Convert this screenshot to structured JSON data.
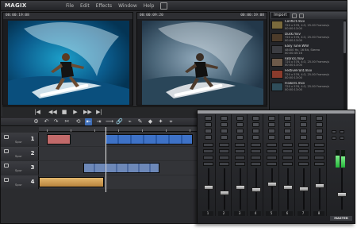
{
  "app": {
    "logo": "MAGIX",
    "menu": [
      "File",
      "Edit",
      "Effects",
      "Window",
      "Help"
    ]
  },
  "monitors": {
    "left_timecode": "00:00:19:08",
    "right_timecode_left": "00:00:09:20",
    "right_timecode_right": "00:00:19:08"
  },
  "import_panel": {
    "tab": "Import",
    "items": [
      {
        "name": "Conflict.mxv",
        "meta": "720 x 576, 4:3, 25.00 Frames/s",
        "dur": "00:00:13:00",
        "thumb": "#7a6a3c"
      },
      {
        "name": "Dusk.mxv",
        "meta": "720 x 576, 4:3, 25.00 Frames/s",
        "dur": "00:00:13:00",
        "thumb": "#4c3b2a"
      },
      {
        "name": "Easy Tune.WAV",
        "meta": "48000 Hz, 16 Bit, Stereo",
        "dur": "00:00:45:16",
        "thumb": "#3c3d42"
      },
      {
        "name": "Fabrics.mxv",
        "meta": "720 x 576, 4:3, 25.00 Frames/s",
        "dur": "00:00:13:00",
        "thumb": "#6d5a4a"
      },
      {
        "name": "FestiveFront.mxv",
        "meta": "720 x 576, 4:3, 25.00 Frames/s",
        "dur": "00:00:13:00",
        "thumb": "#8a3b2c"
      },
      {
        "name": "Flowers.mxv",
        "meta": "720 x 576, 4:3, 25.00 Frames/s",
        "dur": "00:00:13:00",
        "thumb": "#2f4d5a"
      }
    ]
  },
  "transport": {
    "buttons": [
      "|◀",
      "◀◀",
      "■",
      "▶",
      "▶▶",
      "▶|"
    ]
  },
  "toolbar": {
    "tools": [
      "⚙",
      "↶",
      "↷",
      "✂",
      "⟲",
      "⇤",
      "⇥",
      "⟶",
      "🔗",
      "⌁",
      "✎",
      "◆",
      "✦",
      "⌖"
    ]
  },
  "tracks": [
    {
      "num": "1",
      "label": "Spur",
      "clips": [
        {
          "title": "",
          "color": "#c26a6a",
          "start": 10,
          "width": 18
        },
        {
          "title": "",
          "color": "#3e72c7",
          "start": 30,
          "width": 68
        }
      ]
    },
    {
      "num": "2",
      "label": "Spur",
      "clips": []
    },
    {
      "num": "3",
      "label": "Spur",
      "clips": [
        {
          "title": "",
          "color": "#3e72c7",
          "start": 28,
          "width": 64
        }
      ]
    },
    {
      "num": "4",
      "label": "Spur",
      "clips": [
        {
          "title": "",
          "color": "#d2a25a",
          "start": 0,
          "width": 40
        }
      ]
    }
  ],
  "mixer": {
    "channels": [
      {
        "num": "1",
        "fader": 0.55
      },
      {
        "num": "2",
        "fader": 0.4
      },
      {
        "num": "3",
        "fader": 0.55
      },
      {
        "num": "4",
        "fader": 0.48
      },
      {
        "num": "5",
        "fader": 0.62
      },
      {
        "num": "6",
        "fader": 0.55
      },
      {
        "num": "7",
        "fader": 0.5
      },
      {
        "num": "8",
        "fader": 0.58
      }
    ],
    "master_label": "MASTER",
    "master_fader": 0.35,
    "meter_levels": [
      0.7,
      0.65
    ]
  }
}
